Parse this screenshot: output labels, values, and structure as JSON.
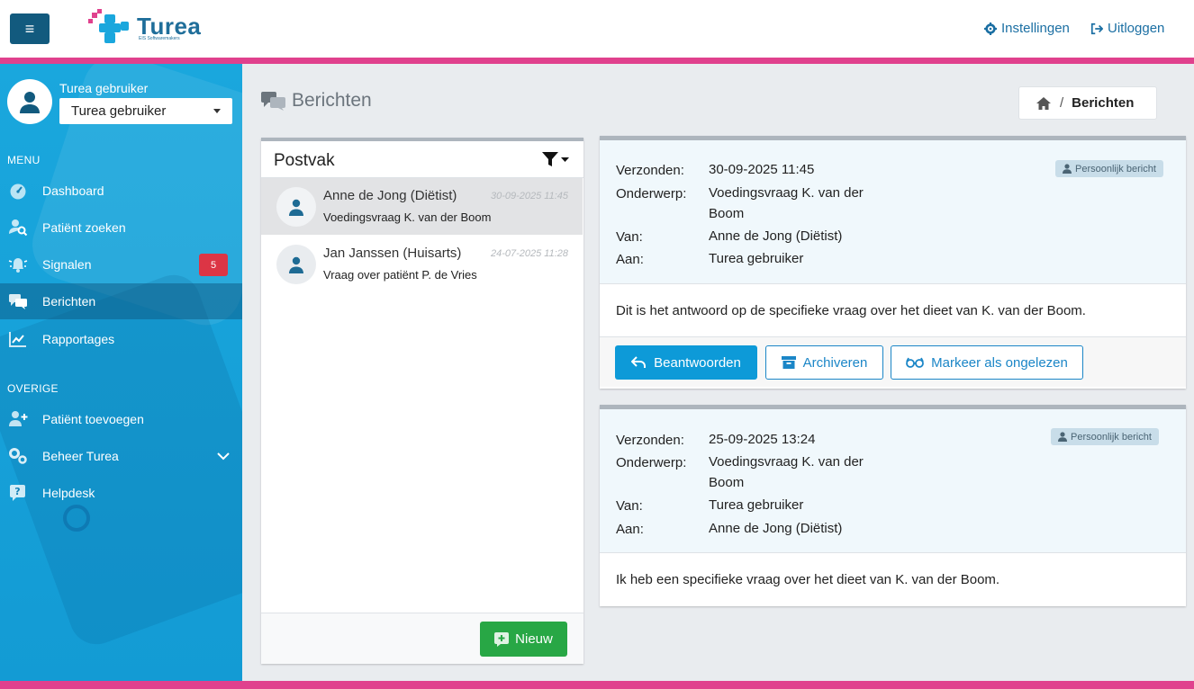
{
  "header": {
    "menu_glyph": "≡",
    "logo_text": "Turea",
    "logo_sub": "EIS Softwaremakers",
    "settings_label": "Instellingen",
    "logout_label": "Uitloggen"
  },
  "sidebar": {
    "user_name": "Turea gebruiker",
    "user_select_value": "Turea gebruiker",
    "menu_label": "MENU",
    "other_label": "OVERIGE",
    "items": [
      {
        "label": "Dashboard",
        "icon": "dashboard-icon"
      },
      {
        "label": "Patiënt zoeken",
        "icon": "user-search-icon"
      },
      {
        "label": "Signalen",
        "icon": "bell-icon",
        "badge": "5"
      },
      {
        "label": "Berichten",
        "icon": "comments-icon",
        "active": true
      },
      {
        "label": "Rapportages",
        "icon": "chart-line-icon"
      }
    ],
    "other_items": [
      {
        "label": "Patiënt toevoegen",
        "icon": "user-plus-icon"
      },
      {
        "label": "Beheer Turea",
        "icon": "gears-icon"
      },
      {
        "label": "Helpdesk",
        "icon": "question-icon"
      }
    ]
  },
  "page": {
    "title": "Berichten",
    "breadcrumb_current": "Berichten",
    "breadcrumb_sep": "/"
  },
  "postvak": {
    "title": "Postvak",
    "new_button": "Nieuw",
    "messages": [
      {
        "from": "Anne de Jong (Diëtist)",
        "date": "30-09-2025 11:45",
        "subject": "Voedingsvraag K. van der Boom"
      },
      {
        "from": "Jan Janssen (Huisarts)",
        "date": "24-07-2025 11:28",
        "subject": "Vraag over patiënt P. de Vries"
      }
    ]
  },
  "labels": {
    "sent": "Verzonden:",
    "subject": "Onderwerp:",
    "from": "Van:",
    "to": "Aan:",
    "personal": "Persoonlijk bericht"
  },
  "detail": [
    {
      "sent": "30-09-2025 11:45",
      "subject_line1": "Voedingsvraag K. van der",
      "subject_line2": "Boom",
      "from": "Anne de Jong (Diëtist)",
      "to": "Turea gebruiker",
      "body": "Dit is het antwoord op de specifieke vraag over het dieet van K. van der Boom."
    },
    {
      "sent": "25-09-2025 13:24",
      "subject_line1": "Voedingsvraag K. van der",
      "subject_line2": "Boom",
      "from": "Turea gebruiker",
      "to": "Anne de Jong (Diëtist)",
      "body": "Ik heb een specifieke vraag over het dieet van K. van der Boom."
    }
  ],
  "actions": {
    "reply": "Beantwoorden",
    "archive": "Archiveren",
    "mark_unread": "Markeer als ongelezen"
  },
  "colors": {
    "primary": "#0d9ad8",
    "brand_dark": "#125a7e",
    "accent_pink": "#e0418d",
    "success": "#28a745",
    "danger": "#dc3545"
  }
}
